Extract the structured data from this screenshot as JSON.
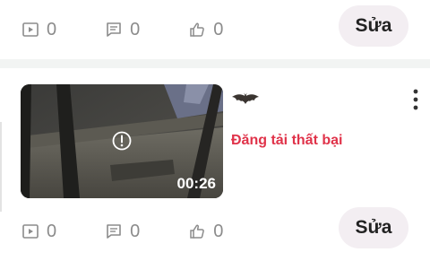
{
  "top_post": {
    "views": "0",
    "comments": "0",
    "likes": "0",
    "edit_label": "Sửa"
  },
  "upload_card": {
    "duration": "00:26",
    "status": "Đăng tải thất bại"
  },
  "bottom_post": {
    "views": "0",
    "comments": "0",
    "likes": "0",
    "edit_label": "Sửa"
  },
  "colors": {
    "error": "#e0334a",
    "icon_gray": "#8b8b8b",
    "button_bg": "#f3eef2"
  }
}
